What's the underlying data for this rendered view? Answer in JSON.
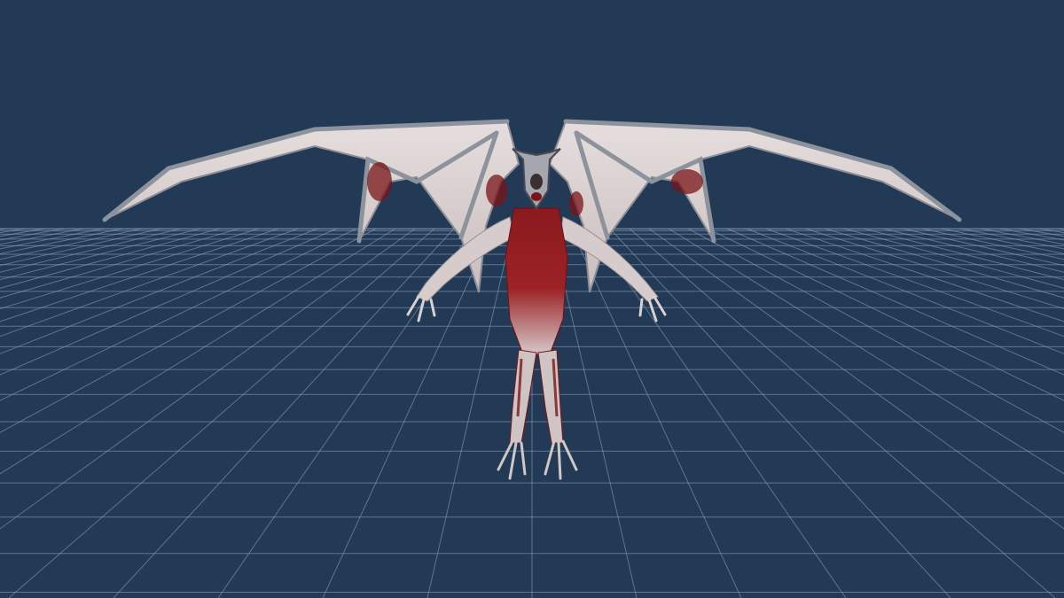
{
  "viewport": {
    "background_color": "#223a56",
    "grid_color": "#8fa6bd",
    "grid_visible": true,
    "model_name_icon": "winged-demon-model-icon"
  },
  "model": {
    "wing_membrane_color": "#d8d0d0",
    "wing_bone_color": "#9aa0a8",
    "skin_color": "#d9cfcf",
    "blood_color": "#7a1418",
    "dark_color": "#3a3032"
  }
}
